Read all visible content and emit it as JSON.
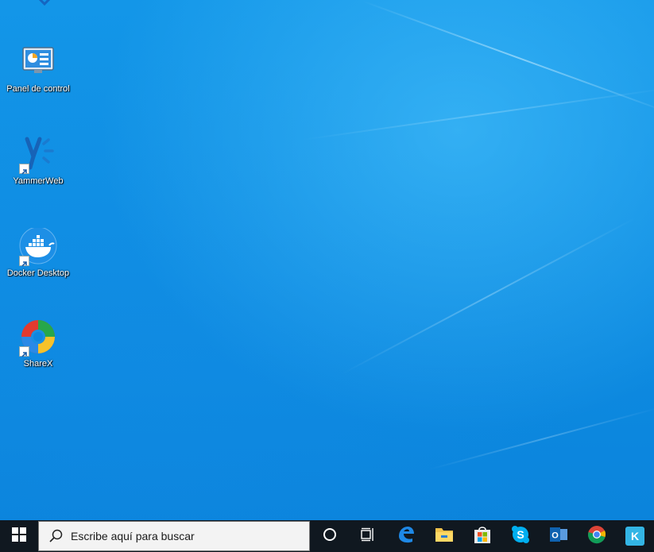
{
  "desktop": {
    "icons": [
      {
        "label": "Panel de control",
        "icon": "control-panel-icon"
      },
      {
        "label": "YammerWeb",
        "icon": "yammer-icon"
      },
      {
        "label": "Docker Desktop",
        "icon": "docker-icon"
      },
      {
        "label": "ShareX",
        "icon": "sharex-icon"
      }
    ]
  },
  "taskbar": {
    "search_placeholder": "Escribe aquí para buscar",
    "pinned": [
      "cortana-icon",
      "task-view-icon",
      "edge-icon",
      "file-explorer-icon",
      "store-icon",
      "skype-icon",
      "outlook-icon",
      "chrome-icon",
      "app-icon"
    ],
    "last_app_letter": "K"
  },
  "colors": {
    "desktop_blue": "#0f8ee3",
    "taskbar": "#101820"
  }
}
